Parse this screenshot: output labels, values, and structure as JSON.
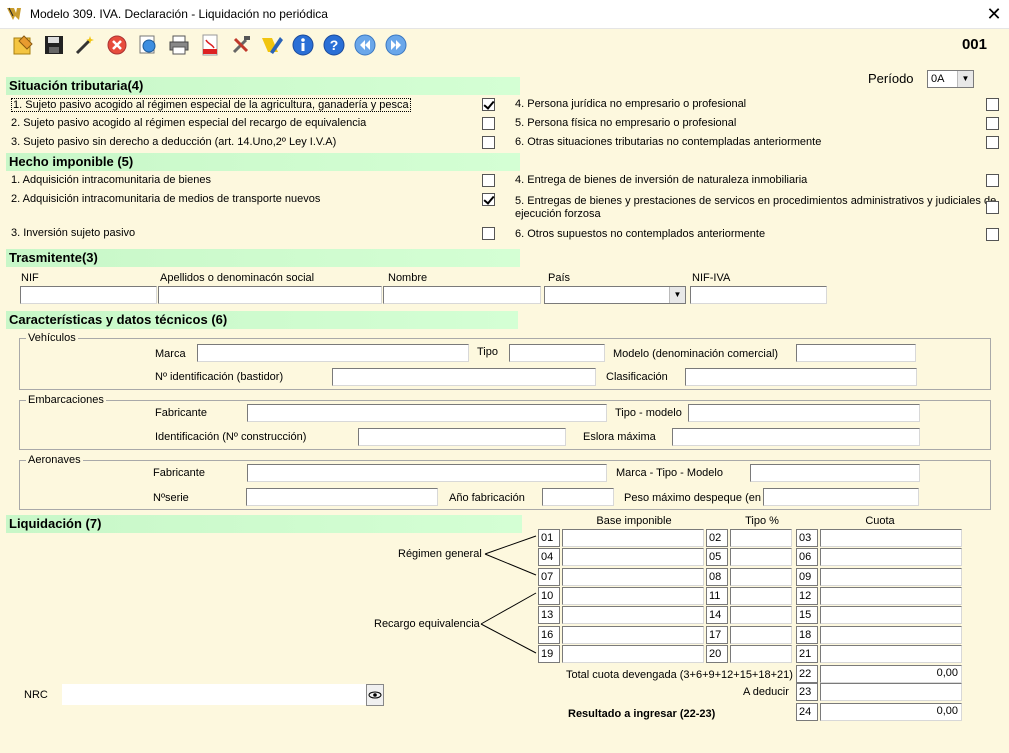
{
  "window": {
    "title": "Modelo 309. IVA. Declaración - Liquidación no periódica",
    "close": "✕"
  },
  "toolbar": {
    "icons": [
      "new-icon",
      "save-icon",
      "wand-icon",
      "cancel-icon",
      "preview-icon",
      "print-icon",
      "pdf-icon",
      "tools-icon",
      "tax-agency-icon",
      "info-icon",
      "help-icon",
      "back-icon",
      "forward-icon"
    ]
  },
  "form_number": "001",
  "periodo": {
    "label": "Período",
    "value": "0A"
  },
  "situacion": {
    "title": "Situación tributaria(4)",
    "left": [
      {
        "label": "1. Sujeto pasivo acogido al régimen especial de la agricultura, ganadería y pesca",
        "checked": true
      },
      {
        "label": "2. Sujeto pasivo acogido al régimen especial del recargo de equivalencia",
        "checked": false
      },
      {
        "label": "3. Sujeto pasivo sin derecho a deducción (art. 14.Uno,2º Ley I.V.A)",
        "checked": false
      }
    ],
    "right": [
      {
        "label": "4. Persona jurídica no empresario o profesional",
        "checked": false
      },
      {
        "label": "5. Persona física no empresario o profesional",
        "checked": false
      },
      {
        "label": "6. Otras situaciones tributarias no contempladas anteriormente",
        "checked": false
      }
    ]
  },
  "hecho": {
    "title": "Hecho imponible (5)",
    "left": [
      {
        "label": "1. Adquisición intracomunitaria de bienes",
        "checked": false
      },
      {
        "label": "2. Adquisición intracomunitaria de medios de transporte nuevos",
        "checked": true
      },
      {
        "label": "3. Inversión sujeto pasivo",
        "checked": false
      }
    ],
    "right": [
      {
        "label": "4. Entrega de bienes de inversión de naturaleza inmobiliaria",
        "checked": false
      },
      {
        "label_line1": "5. Entregas de bienes y prestaciones de servicos en procedimientos administrativos y judiciales de",
        "label_line2": "ejecución forzosa",
        "checked": false
      },
      {
        "label": "6. Otros supuestos no contemplados anteriormente",
        "checked": false
      }
    ]
  },
  "trasmitente": {
    "title": "Trasmitente(3)",
    "nif": "NIF",
    "apellidos": "Apellidos o denominacón social",
    "nombre": "Nombre",
    "pais": "País",
    "nif_iva": "NIF-IVA"
  },
  "caracteristicas": {
    "title": "Características y datos técnicos (6)",
    "vehiculos": {
      "title": "Vehículos",
      "marca": "Marca",
      "tipo": "Tipo",
      "modelo": "Modelo (denominación comercial)",
      "identificacion": "Nº identificación (bastidor)",
      "clasificacion": "Clasificación"
    },
    "embarcaciones": {
      "title": "Embarcaciones",
      "fabricante": "Fabricante",
      "tipo_modelo": "Tipo - modelo",
      "identificacion": "Identificación (Nº construcción)",
      "eslora": "Eslora máxima"
    },
    "aeronaves": {
      "title": "Aeronaves",
      "fabricante": "Fabricante",
      "marca_tipo_modelo": "Marca - Tipo - Modelo",
      "nserie": "Nºserie",
      "anio": "Año fabricación",
      "peso": "Peso máximo despeque (en Kg)"
    }
  },
  "liquidacion": {
    "title": "Liquidación (7)",
    "col_base": "Base imponible",
    "col_tipo": "Tipo %",
    "col_cuota": "Cuota",
    "regimen_general": "Régimen general",
    "recargo": "Recargo equivalencia",
    "rows": [
      [
        "01",
        "02",
        "03"
      ],
      [
        "04",
        "05",
        "06"
      ],
      [
        "07",
        "08",
        "09"
      ],
      [
        "10",
        "11",
        "12"
      ],
      [
        "13",
        "14",
        "15"
      ],
      [
        "16",
        "17",
        "18"
      ],
      [
        "19",
        "20",
        "21"
      ]
    ],
    "total_label": "Total cuota devengada (3+6+9+12+15+18+21)",
    "total_code": "22",
    "total_value": "0,00",
    "deducir_label": "A deducir",
    "deducir_code": "23",
    "resultado_label": "Resultado a ingresar (22-23)",
    "resultado_code": "24",
    "resultado_value": "0,00"
  },
  "nrc": {
    "label": "NRC"
  }
}
